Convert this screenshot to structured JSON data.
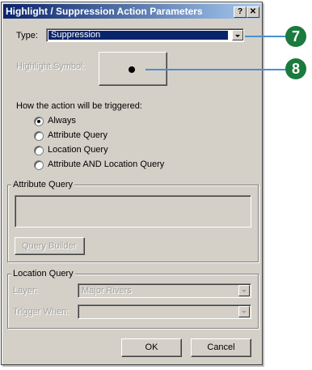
{
  "dialog": {
    "title": "Highlight / Suppression Action Parameters",
    "help_button": "?",
    "close_button": "✕"
  },
  "type_field": {
    "label": "Type:",
    "value": "Suppression"
  },
  "highlight_symbol": {
    "label": "Highlight Symbol:"
  },
  "trigger": {
    "heading": "How the action will be triggered:",
    "options": [
      "Always",
      "Attribute Query",
      "Location Query",
      "Attribute AND Location Query"
    ],
    "selected": "Always"
  },
  "attribute_query": {
    "title": "Attribute Query",
    "builder_button": "Query Builder"
  },
  "location_query": {
    "title": "Location Query",
    "layer_label": "Layer:",
    "layer_value": "Major Rivers",
    "trigger_label": "Trigger When:",
    "trigger_value": ""
  },
  "buttons": {
    "ok": "OK",
    "cancel": "Cancel"
  },
  "callouts": {
    "first": "7",
    "second": "8"
  },
  "colors": {
    "titlebar": "#0a246a",
    "selection": "#0a246a",
    "callout": "#1b7a3d",
    "callout_line": "#4a8fd0"
  }
}
